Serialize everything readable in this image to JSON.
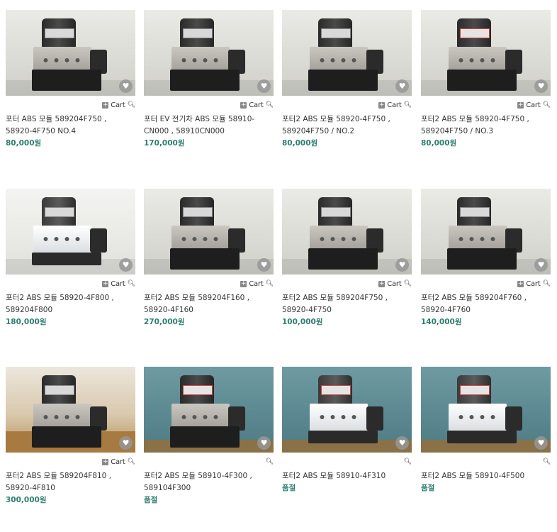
{
  "cart_label": "Cart",
  "products": [
    {
      "title": "포터 ABS 모듈 589204F750 , 58920-4F750 NO.4",
      "price": "80,000원",
      "has_cart": true
    },
    {
      "title": "포터 EV 전기차 ABS 모듈 58910-CN000 , 58910CN000",
      "price": "170,000원",
      "has_cart": true
    },
    {
      "title": "포터2 ABS 모듈 58920-4F750 , 589204F750 / NO.2",
      "price": "80,000원",
      "has_cart": true
    },
    {
      "title": "포터2 ABS 모듈 58920-4F750 , 589204F750 / NO.3",
      "price": "80,000원",
      "has_cart": true
    },
    {
      "title": "포터2 ABS 모듈 58920-4F800 , 589204F800",
      "price": "180,000원",
      "has_cart": true
    },
    {
      "title": "포터2 ABS 모듈 589204F160 , 58920-4F160",
      "price": "270,000원",
      "has_cart": true
    },
    {
      "title": "포터2 ABS 모듈 589204F750 , 58920-4F750",
      "price": "100,000원",
      "has_cart": true
    },
    {
      "title": "포터2 ABS 모듈 589204F760 , 58920-4F760",
      "price": "140,000원",
      "has_cart": true
    },
    {
      "title": "포터2 ABS 모듈 589204F810 , 58920-4F810",
      "price": "300,000원",
      "has_cart": true
    },
    {
      "title": "포터2 ABS 모듈 58910-4F300 , 589104F300",
      "price": "품절",
      "has_cart": false
    },
    {
      "title": "포터2 ABS 모듈 58910-4F310",
      "price": "품절",
      "has_cart": false
    },
    {
      "title": "포터2 ABS 모듈 58910-4F500",
      "price": "품절",
      "has_cart": false
    }
  ],
  "icons": {
    "wishlist": "heart-icon",
    "zoom": "magnifier-icon",
    "add": "plus-icon"
  },
  "colors": {
    "price": "#2e7d6e",
    "text": "#333333"
  }
}
